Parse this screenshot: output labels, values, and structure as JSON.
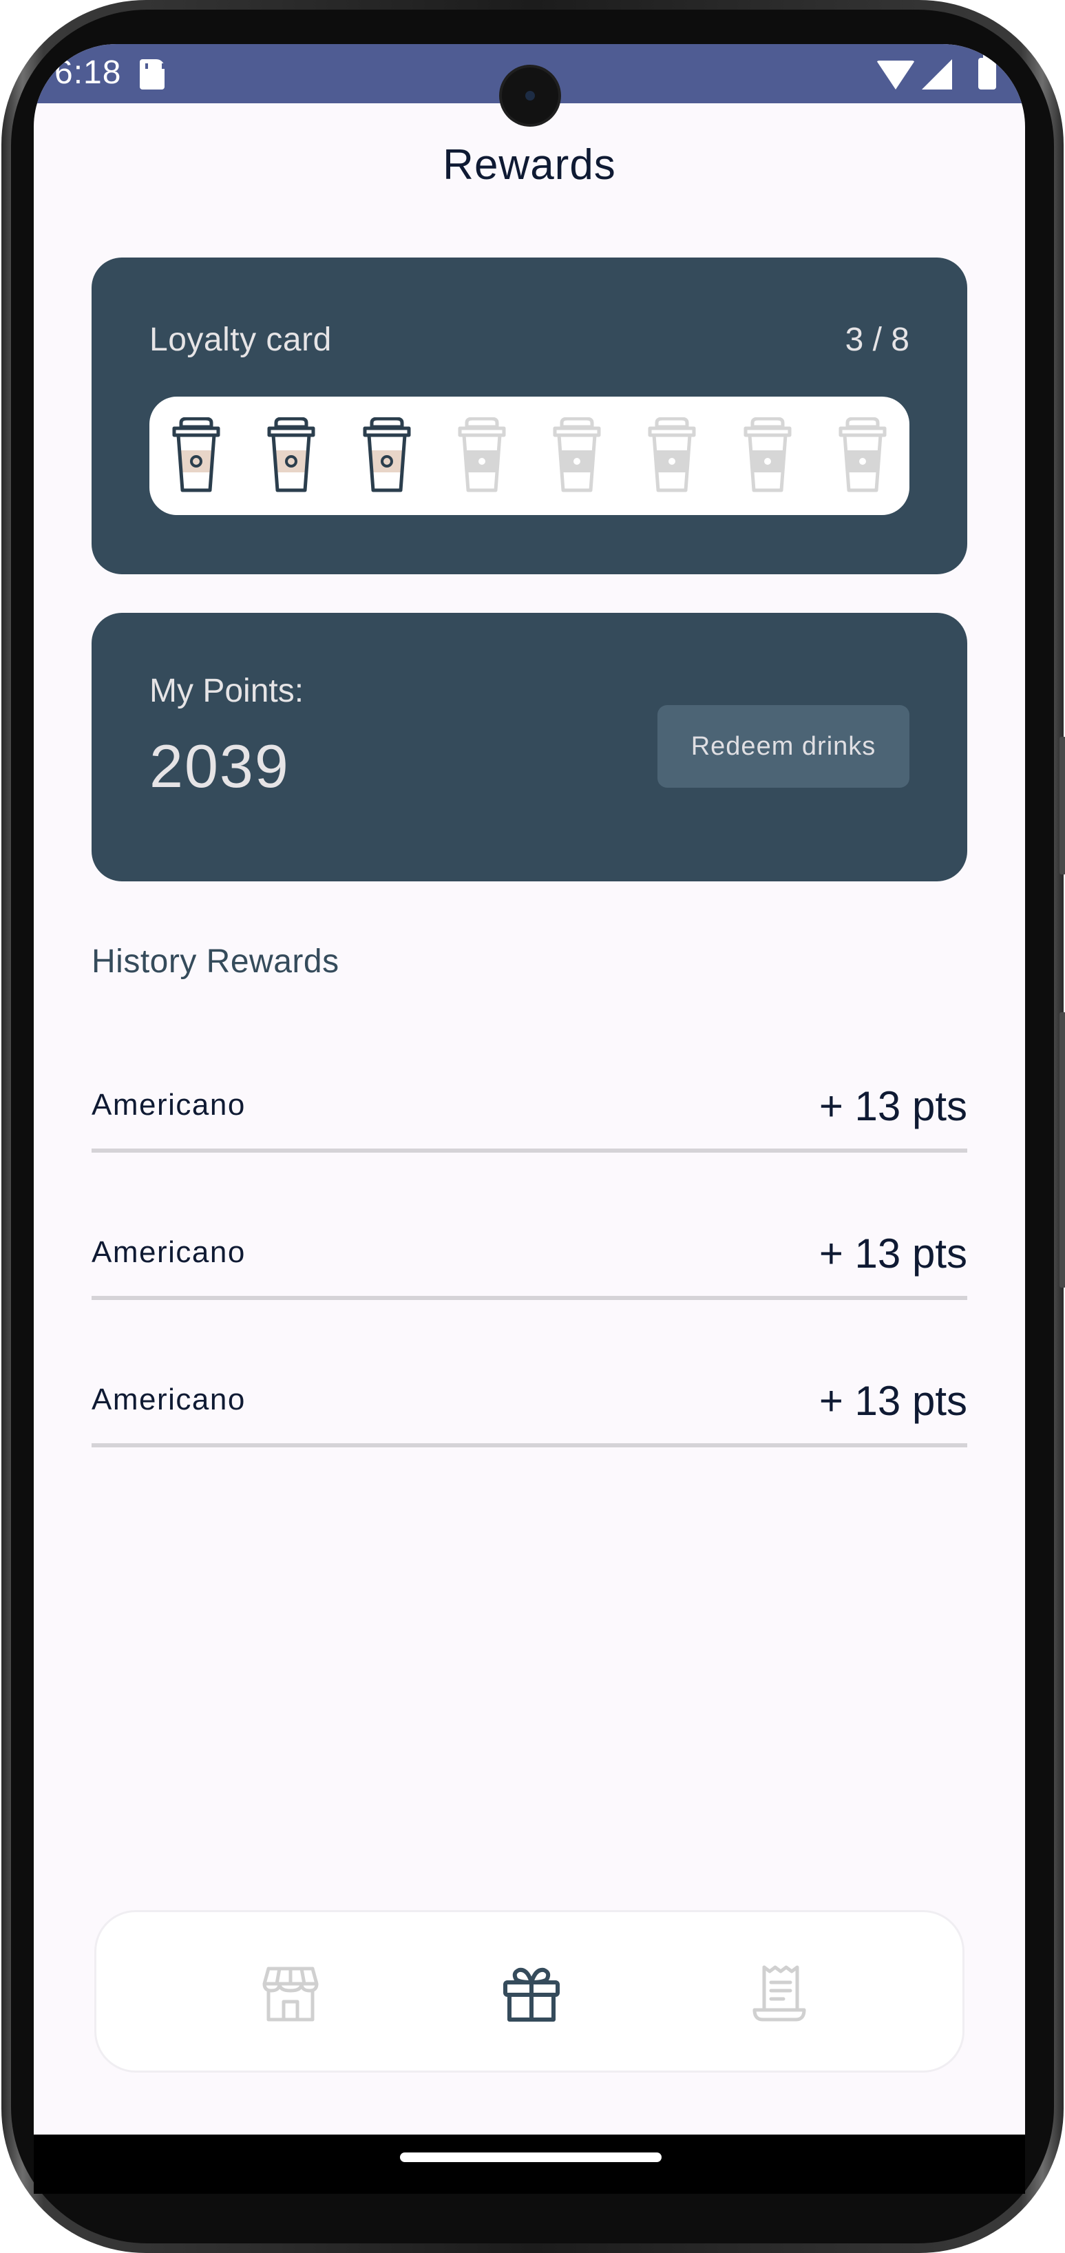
{
  "status_bar": {
    "time": "6:18",
    "icons": [
      "sd-card-icon",
      "wifi-icon",
      "signal-icon",
      "battery-icon"
    ]
  },
  "page": {
    "title": "Rewards"
  },
  "loyalty_card": {
    "title": "Loyalty card",
    "count_text": "3 / 8",
    "stamps_filled": 3,
    "stamps_total": 8
  },
  "points_card": {
    "label": "My Points:",
    "value": "2039",
    "redeem_label": "Redeem drinks"
  },
  "history": {
    "heading": "History Rewards",
    "items": [
      {
        "name": "Americano",
        "points": "+ 13 pts"
      },
      {
        "name": "Americano",
        "points": "+ 13 pts"
      },
      {
        "name": "Americano",
        "points": "+ 13 pts"
      }
    ]
  },
  "bottom_nav": {
    "items": [
      {
        "icon": "store-icon",
        "active": false
      },
      {
        "icon": "gift-icon",
        "active": true
      },
      {
        "icon": "receipt-icon",
        "active": false
      }
    ]
  },
  "colors": {
    "status_bar": "#4f5c93",
    "card": "#354b5b",
    "redeem_button": "#4c6475",
    "cup_filled_band": "#e8d5c8",
    "cup_empty": "#d6d6d6",
    "nav_active": "#354b5b",
    "nav_inactive": "#d0d0d0"
  }
}
